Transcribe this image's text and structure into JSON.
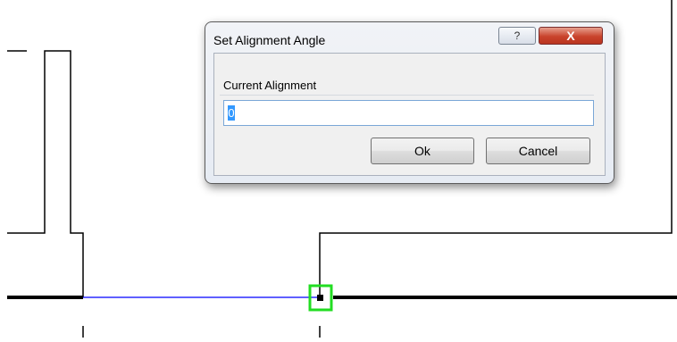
{
  "dialog": {
    "title": "Set Alignment Angle",
    "help_icon": "question-mark-icon",
    "close_icon": "close-x-icon",
    "help_glyph": "?",
    "close_glyph": "X",
    "group_label": "Current Alignment",
    "input_value": "0",
    "ok_label": "Ok",
    "cancel_label": "Cancel"
  },
  "canvas": {
    "background": "#ffffff",
    "line_color": "#000000",
    "alignment_line_color": "#0000ff",
    "snap_marker_color": "#22dd22"
  }
}
